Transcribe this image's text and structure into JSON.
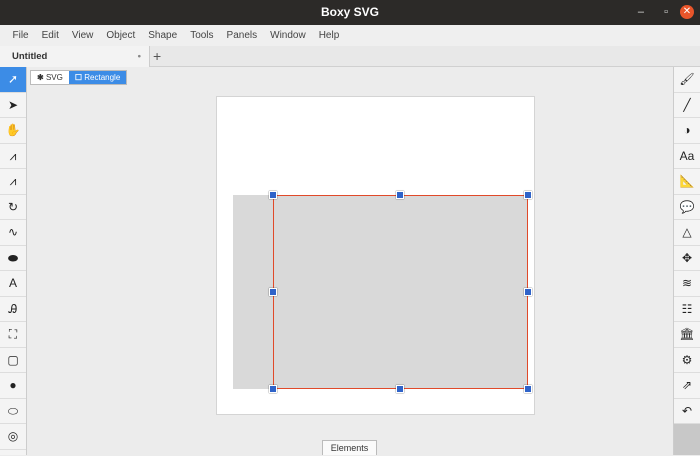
{
  "window": {
    "title": "Boxy SVG",
    "minimize": "‒",
    "restore": "▫",
    "close": "✕"
  },
  "menu": [
    "File",
    "Edit",
    "View",
    "Object",
    "Shape",
    "Tools",
    "Panels",
    "Window",
    "Help"
  ],
  "tabs": [
    {
      "label": "Untitled",
      "modified_dot": "•"
    }
  ],
  "new_tab": "+",
  "breadcrumb": [
    {
      "icon": "✱",
      "label": "SVG"
    },
    {
      "icon": "☐",
      "label": "Rectangle"
    }
  ],
  "left_tools": [
    {
      "name": "select-tool",
      "glyph": "➚"
    },
    {
      "name": "edit-tool",
      "glyph": "➤"
    },
    {
      "name": "pan-tool",
      "glyph": "✋"
    },
    {
      "name": "bezier-tool",
      "glyph": "⩘"
    },
    {
      "name": "triangle-tool",
      "glyph": "⩘"
    },
    {
      "name": "arc-tool",
      "glyph": "↻"
    },
    {
      "name": "freehand-tool",
      "glyph": "∿"
    },
    {
      "name": "ellipse-fill-tool",
      "glyph": "⬬"
    },
    {
      "name": "text-tool",
      "glyph": "A"
    },
    {
      "name": "text-path-tool",
      "glyph": "Ꭿ"
    },
    {
      "name": "crop-tool",
      "glyph": "⛶"
    },
    {
      "name": "rectangle-tool",
      "glyph": "▢"
    },
    {
      "name": "circle-tool",
      "glyph": "●"
    },
    {
      "name": "ellipse-tool",
      "glyph": "⬭"
    },
    {
      "name": "ring-tool",
      "glyph": "◎"
    }
  ],
  "right_panels": [
    {
      "name": "fill-panel",
      "glyph": "🖌"
    },
    {
      "name": "stroke-panel",
      "glyph": "╱"
    },
    {
      "name": "compositing-panel",
      "glyph": "◑"
    },
    {
      "name": "typography-panel",
      "glyph": "Aa"
    },
    {
      "name": "geometry-panel",
      "glyph": "📐"
    },
    {
      "name": "comments-panel",
      "glyph": "💬"
    },
    {
      "name": "defs-panel",
      "glyph": "△"
    },
    {
      "name": "transform-panel",
      "glyph": "✥"
    },
    {
      "name": "layers-panel",
      "glyph": "≋"
    },
    {
      "name": "elements-list-panel",
      "glyph": "☷"
    },
    {
      "name": "library-panel",
      "glyph": "🏛"
    },
    {
      "name": "generators-panel",
      "glyph": "⚙"
    },
    {
      "name": "export-panel",
      "glyph": "⇗"
    },
    {
      "name": "history-panel",
      "glyph": "↶"
    }
  ],
  "bottom": {
    "elements_label": "Elements"
  }
}
